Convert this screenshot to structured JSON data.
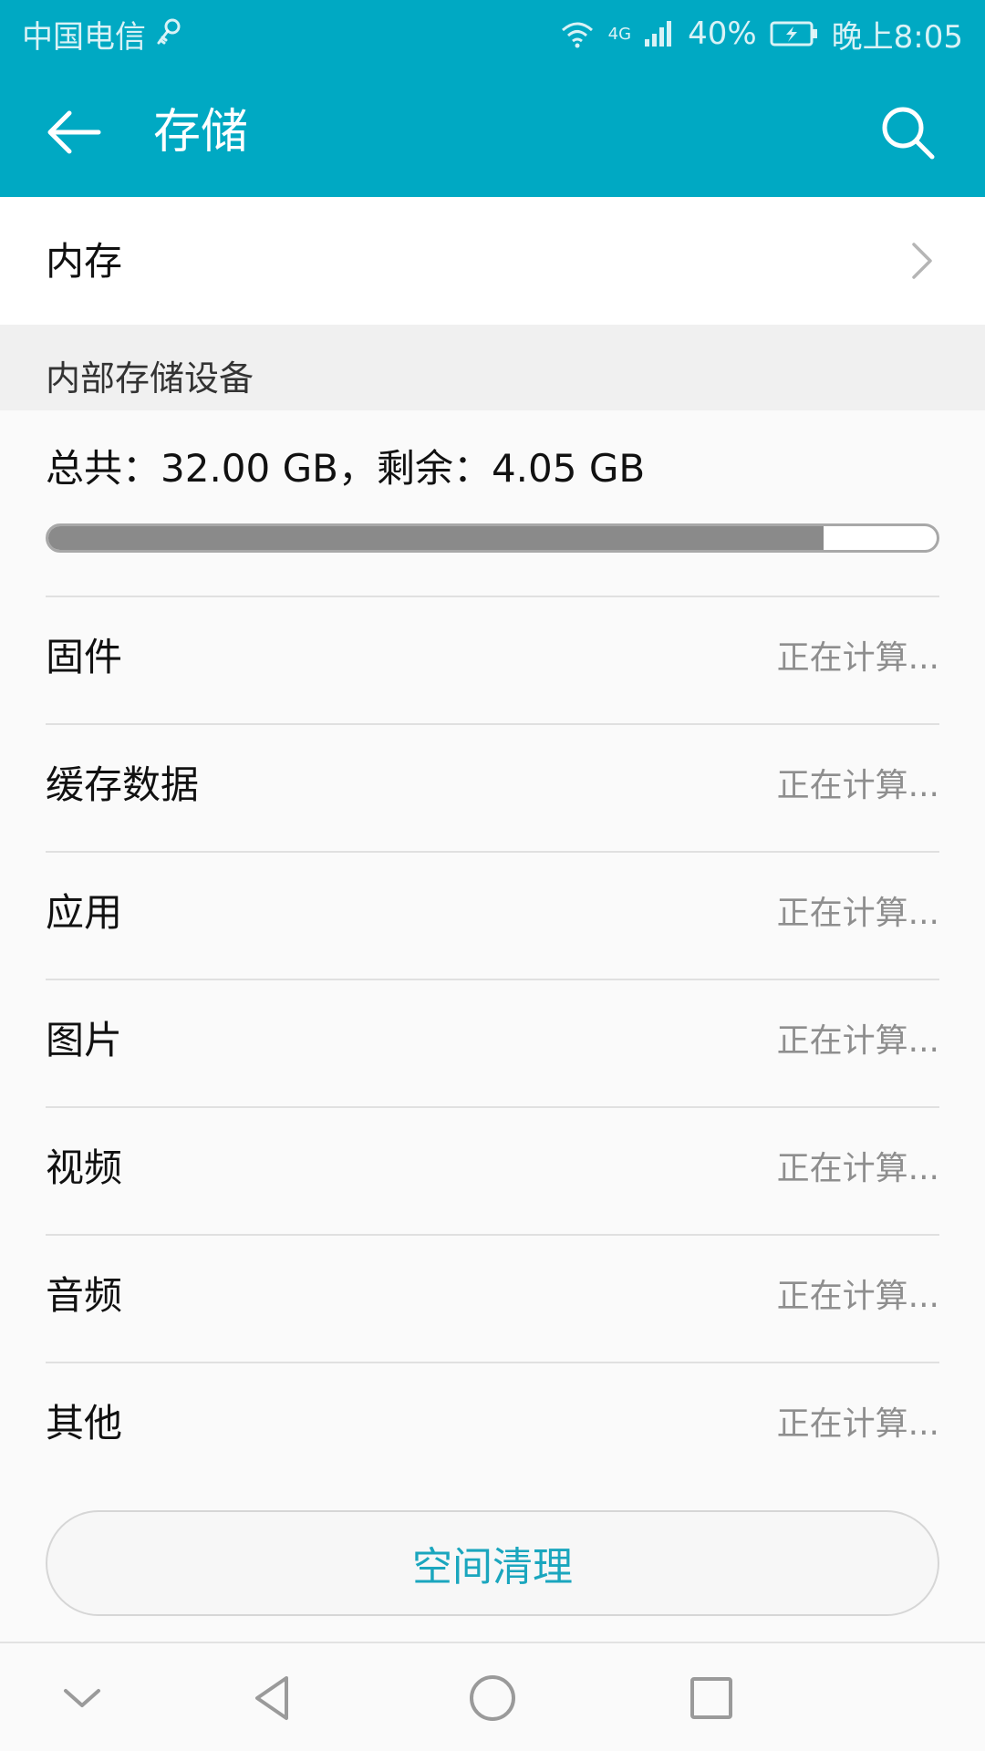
{
  "status_bar": {
    "carrier": "中国电信",
    "network": "4G",
    "battery": "40%",
    "time": "晚上8:05"
  },
  "app_bar": {
    "title": "存储"
  },
  "memory_row": {
    "label": "内存"
  },
  "section": {
    "title": "内部存储设备"
  },
  "storage": {
    "summary": "总共：32.00 GB，剩余：4.05 GB",
    "used_fraction": 0.873
  },
  "rows": [
    {
      "name": "固件",
      "value": "正在计算..."
    },
    {
      "name": "缓存数据",
      "value": "正在计算..."
    },
    {
      "name": "应用",
      "value": "正在计算..."
    },
    {
      "name": "图片",
      "value": "正在计算..."
    },
    {
      "name": "视频",
      "value": "正在计算..."
    },
    {
      "name": "音频",
      "value": "正在计算..."
    },
    {
      "name": "其他",
      "value": "正在计算..."
    }
  ],
  "clean_button": {
    "label": "空间清理"
  },
  "colors": {
    "accent": "#00a9c3",
    "button_text": "#1aa6be",
    "progress_fill": "#8a8a8a",
    "secondary_text": "#8e8e8e"
  }
}
